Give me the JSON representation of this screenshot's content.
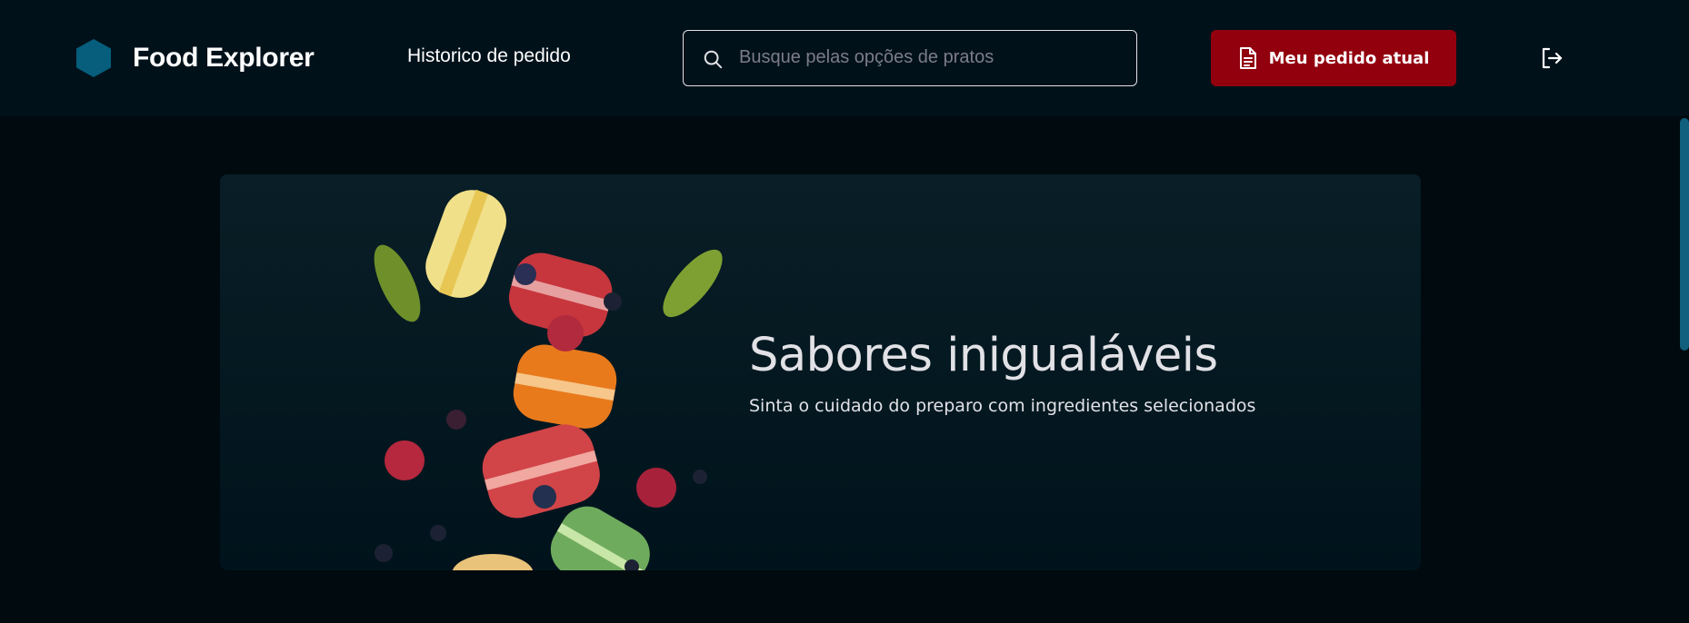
{
  "header": {
    "app_name": "Food Explorer",
    "nav_history": "Historico de pedido",
    "search": {
      "placeholder": "Busque pelas opções de pratos",
      "value": ""
    },
    "order_button": "Meu pedido atual",
    "icons": {
      "logo": "hexagon-logo-icon",
      "search": "search-icon",
      "order": "document-icon",
      "logout": "sign-out-icon"
    }
  },
  "banner": {
    "title": "Sabores inigualáveis",
    "subtitle": "Sinta o cuidado do preparo com ingredientes selecionados"
  },
  "colors": {
    "background": "#000a0f",
    "header_bg": "#00111a",
    "accent_red": "#92000e",
    "logo_blue": "#065e7c",
    "text": "#e1e1e6"
  }
}
